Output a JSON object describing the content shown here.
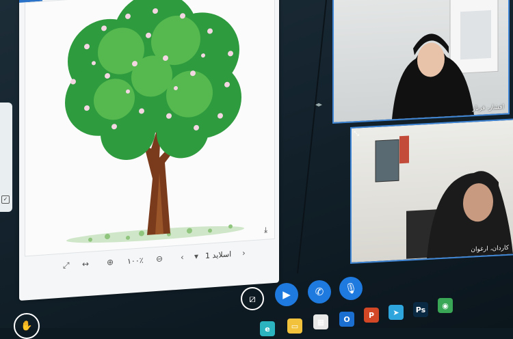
{
  "viewer": {
    "slide_label": "اسلاید 1",
    "zoom": "۱۰۰٪",
    "icons": [
      "expand-icon",
      "fit-width-icon",
      "zoom-in-icon",
      "zoom-out-icon",
      "prev-slide-icon",
      "next-slide-icon",
      "download-icon"
    ]
  },
  "participants": [
    {
      "name": "افشار، فرناز"
    },
    {
      "name": "کاردان، ارغوان"
    }
  ],
  "controls": [
    "share-screen-icon",
    "camera-icon",
    "phone-icon",
    "microphone-icon",
    "raise-hand-icon"
  ],
  "taskbar": {
    "apps": [
      {
        "icon": "edge-icon",
        "glyph": "e",
        "color": "#2bb3c0"
      },
      {
        "icon": "file-explorer-icon",
        "glyph": "▭",
        "color": "#f2c23c"
      },
      {
        "icon": "microsoft-store-icon",
        "glyph": "▦",
        "color": "#e8e8e8"
      },
      {
        "icon": "outlook-icon",
        "glyph": "O",
        "color": "#1a6fd1"
      },
      {
        "icon": "powerpoint-icon",
        "glyph": "P",
        "color": "#d24726"
      },
      {
        "icon": "telegram-icon",
        "glyph": "➤",
        "color": "#2ea6dd"
      },
      {
        "icon": "photoshop-icon",
        "glyph": "Ps",
        "color": "#0a2a44"
      },
      {
        "icon": "chrome-icon",
        "glyph": "◉",
        "color": "#3aa757"
      }
    ]
  },
  "colors": {
    "accent": "#1f7ae0",
    "tile_border": "#3f86d6"
  }
}
